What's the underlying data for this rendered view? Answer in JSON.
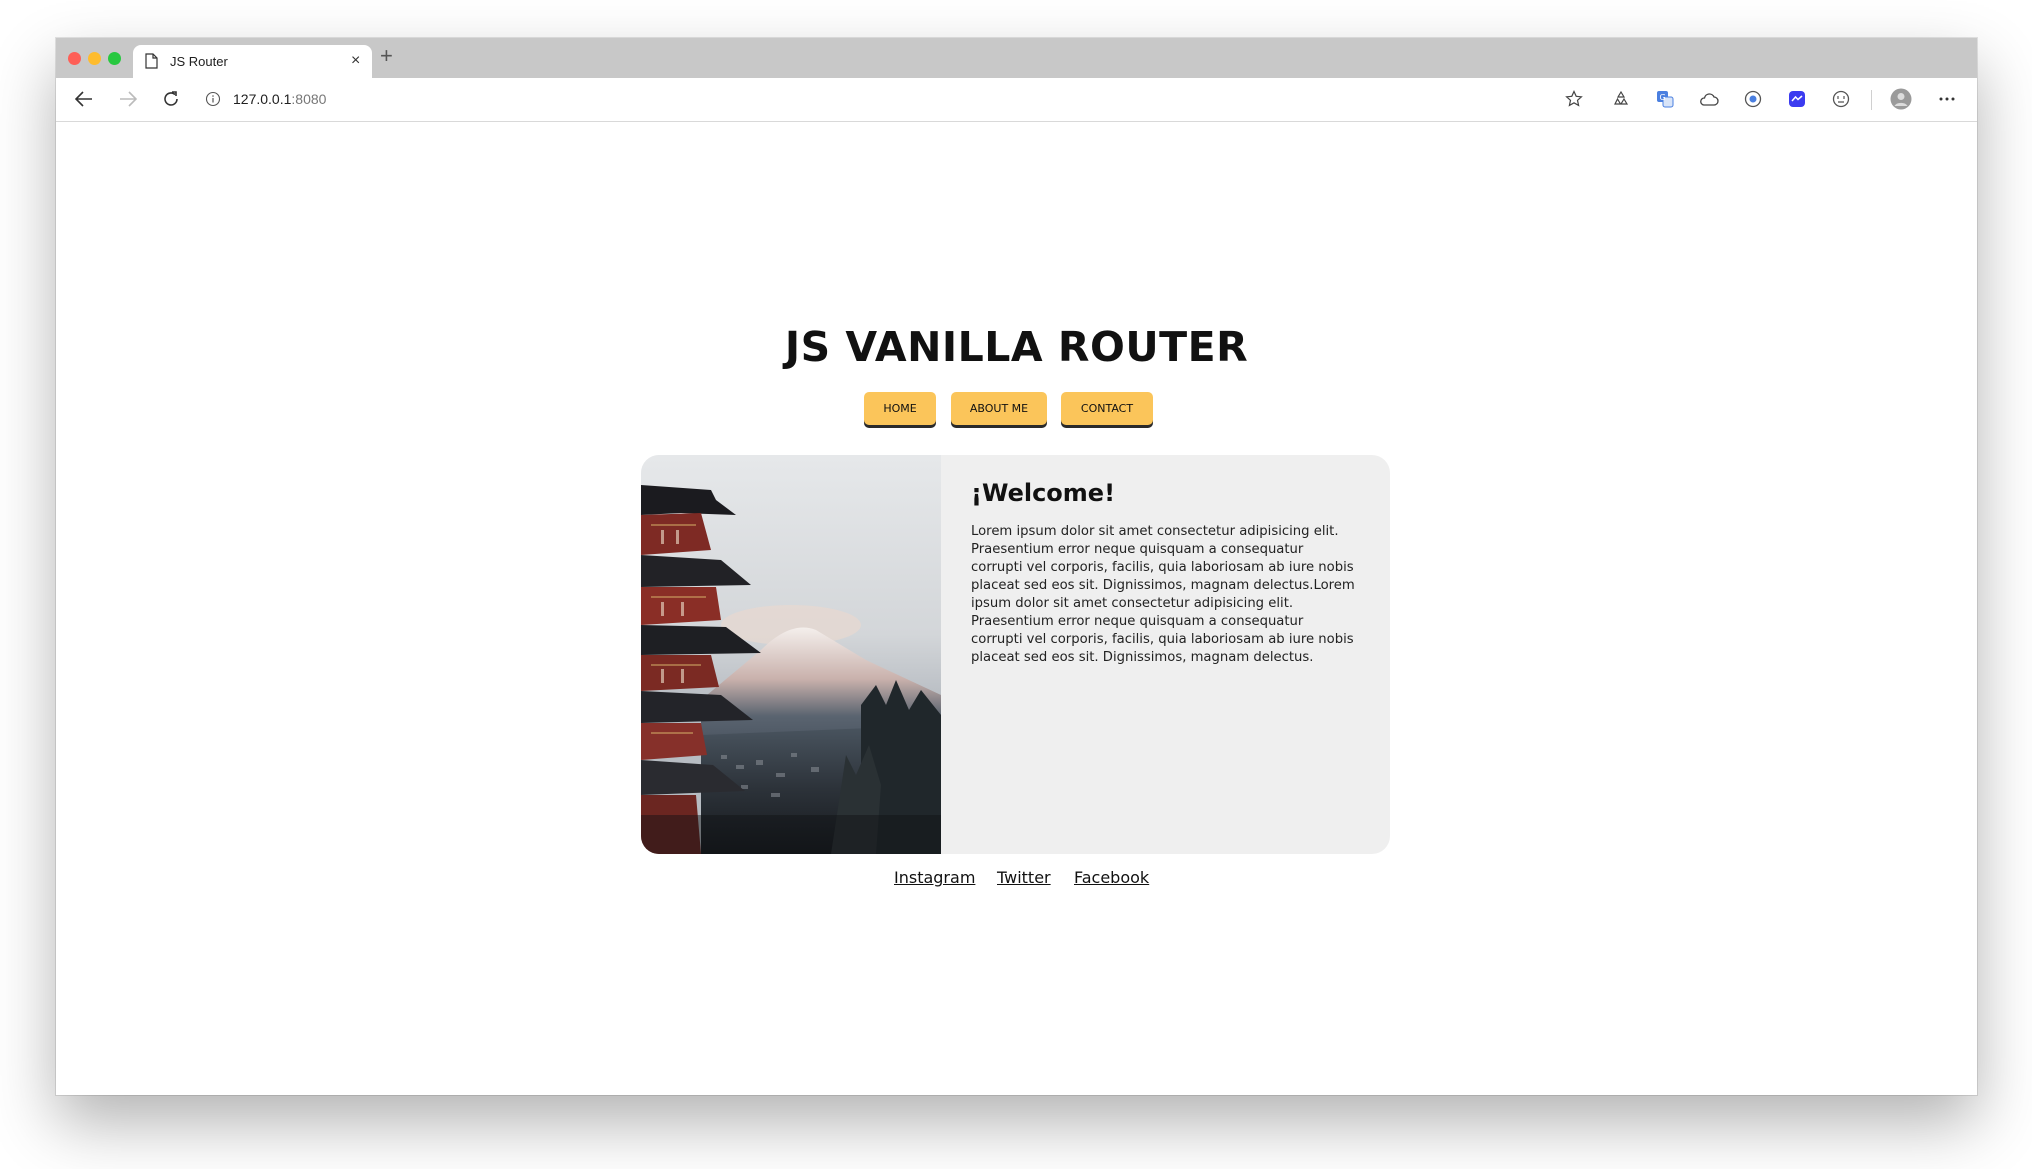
{
  "browser": {
    "tab_title": "JS Router",
    "tab_close": "×",
    "new_tab": "+",
    "address_host": "127.0.0.1",
    "address_port": ":8080",
    "toolbar_icons": [
      "back-icon",
      "forward-icon",
      "reload-icon",
      "info-icon",
      "star-icon",
      "recycle-icon",
      "translate-icon",
      "cloud-icon",
      "shield-icon",
      "messenger-icon",
      "smiley-icon",
      "profile-icon",
      "more-icon"
    ]
  },
  "site": {
    "title": "JS VANILLA ROUTER",
    "nav": [
      "HOME",
      "ABOUT ME",
      "CONTACT"
    ],
    "accent_color": "#fbc55a",
    "card": {
      "heading": "¡Welcome!",
      "text": "Lorem ipsum dolor sit amet consectetur adipisicing elit. Praesentium error neque quisquam a consequatur corrupti vel corporis, facilis, quia laboriosam ab iure nobis placeat sed eos sit. Dignissimos, magnam delectus.Lorem ipsum dolor sit amet consectetur adipisicing elit. Praesentium error neque quisquam a consequatur corrupti vel corporis, facilis, quia laboriosam ab iure nobis placeat sed eos sit. Dignissimos, magnam delectus."
    },
    "footer_links": [
      "Instagram",
      "Twitter",
      "Facebook"
    ]
  }
}
